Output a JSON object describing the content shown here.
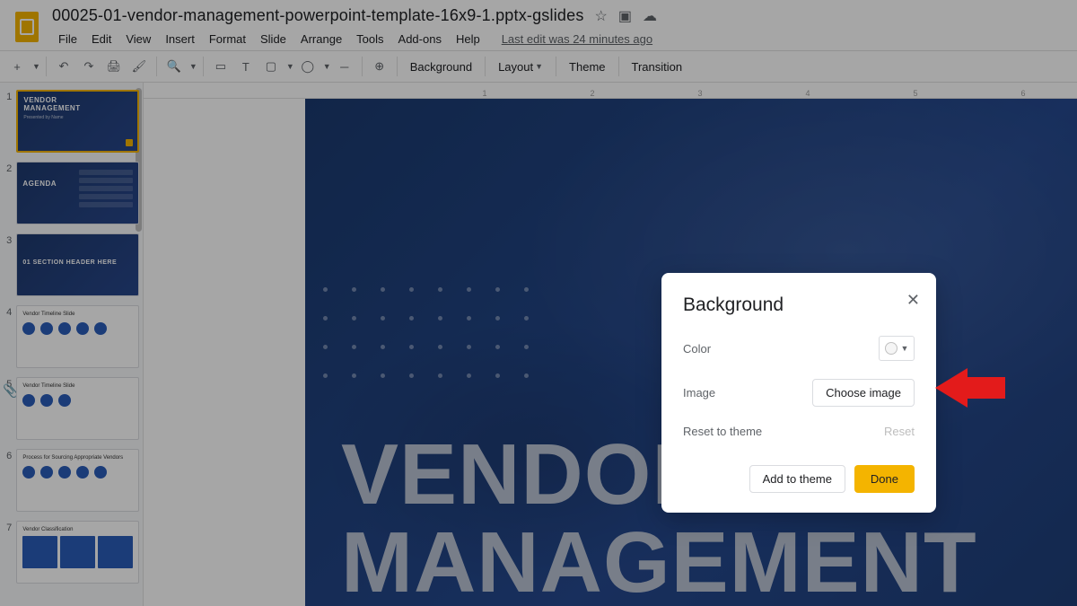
{
  "header": {
    "doc_title": "00025-01-vendor-management-powerpoint-template-16x9-1.pptx-gslides",
    "star_icon": "star-outline-icon",
    "move_icon": "move-to-folder-icon",
    "cloud_icon": "cloud-done-icon"
  },
  "menubar": {
    "items": [
      "File",
      "Edit",
      "View",
      "Insert",
      "Format",
      "Slide",
      "Arrange",
      "Tools",
      "Add-ons",
      "Help"
    ],
    "last_edit": "Last edit was 24 minutes ago"
  },
  "toolbar": {
    "new_slide": "+",
    "undo": "↶",
    "redo": "↷",
    "print": "🖨",
    "paint": "🖌",
    "zoom": "🔍",
    "select": "▭",
    "textbox": "T",
    "image": "▢",
    "shape": "◯",
    "line": "─",
    "comment": "⊕",
    "background": "Background",
    "layout": "Layout",
    "theme": "Theme",
    "transition": "Transition"
  },
  "ruler": {
    "ticks": [
      "",
      "1",
      "2",
      "3",
      "4",
      "5",
      "6"
    ]
  },
  "filmstrip": {
    "slides": [
      {
        "num": "1",
        "sel": true,
        "dark": true,
        "title": "VENDOR",
        "sub": "MANAGEMENT",
        "small": "Presented by Name"
      },
      {
        "num": "2",
        "sel": false,
        "dark": true,
        "title": "AGENDA",
        "sub": "",
        "small": ""
      },
      {
        "num": "3",
        "sel": false,
        "dark": true,
        "title": "01  SECTION HEADER HERE",
        "sub": "",
        "small": ""
      },
      {
        "num": "4",
        "sel": false,
        "dark": false,
        "title": "Vendor Timeline Slide"
      },
      {
        "num": "5",
        "sel": false,
        "dark": false,
        "title": "Vendor Timeline Slide"
      },
      {
        "num": "6",
        "sel": false,
        "dark": false,
        "title": "Process for Sourcing Appropriate Vendors"
      },
      {
        "num": "7",
        "sel": false,
        "dark": false,
        "title": "Vendor Classification"
      }
    ]
  },
  "canvas": {
    "title_line1": "VENDOR",
    "title_line2": "MANAGEMENT"
  },
  "dialog": {
    "title": "Background",
    "row_color": "Color",
    "row_image": "Image",
    "choose_image": "Choose image",
    "row_reset": "Reset to theme",
    "reset": "Reset",
    "add_to_theme": "Add to theme",
    "done": "Done"
  },
  "annotation": {
    "arrow_target": "choose-image-button"
  }
}
